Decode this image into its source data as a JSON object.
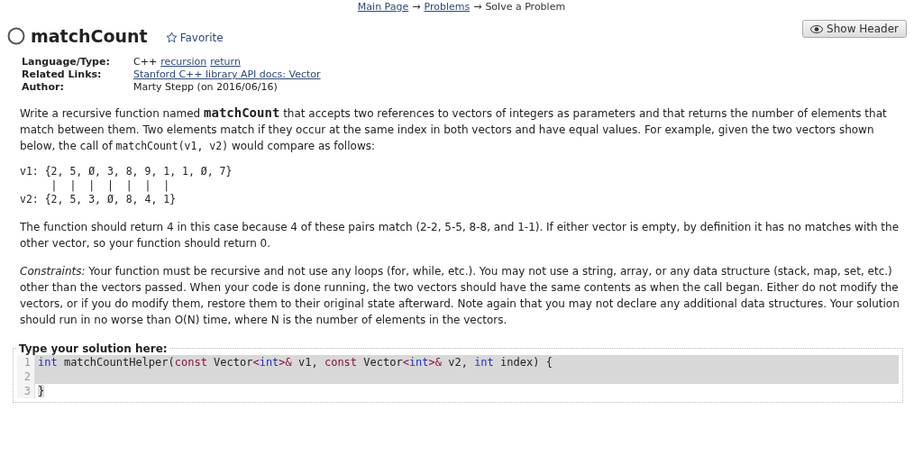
{
  "breadcrumb": [
    {
      "label": "Main Page",
      "link": true
    },
    {
      "label": "→",
      "link": false
    },
    {
      "label": "Problems",
      "link": true
    },
    {
      "label": "→",
      "link": false
    },
    {
      "label": "Solve a Problem",
      "link": false
    }
  ],
  "show_header_button": "Show Header",
  "title": "matchCount",
  "solved": false,
  "favorite": {
    "label": "Favorite",
    "on": false
  },
  "meta": [
    {
      "label": "Language/Type:",
      "values": [
        {
          "text": "C++",
          "link": false
        },
        {
          "text": "recursion",
          "link": true
        },
        {
          "text": "return",
          "link": true
        }
      ]
    },
    {
      "label": "Related Links:",
      "values": [
        {
          "text": "Stanford C++ library API docs: Vector",
          "link": true
        }
      ]
    },
    {
      "label": "Author:",
      "values": [
        {
          "text": "Marty Stepp (on 2016/06/16)",
          "link": false
        }
      ]
    }
  ],
  "intro": [
    {
      "kind": "text",
      "text": "Write a recursive function named "
    },
    {
      "kind": "code-bold",
      "text": "matchCount"
    },
    {
      "kind": "text",
      "text": " that accepts two references to vectors of integers as parameters and that returns the number of elements that match between them. Two elements match if they occur at the same index in both vectors and have equal values. For example, given the two vectors shown below, the call of "
    },
    {
      "kind": "code",
      "text": "matchCount(v1, v2)"
    },
    {
      "kind": "text",
      "text": " would compare as follows:"
    }
  ],
  "example": [
    "v1: {2, 5, Ø, 3, 8, 9, 1, 1, Ø, 7}",
    "     |  |  |  |  |  |  |",
    "v2: {2, 5, 3, Ø, 8, 4, 1}"
  ],
  "explanation": "The function should return 4 in this case because 4 of these pairs match (2-2, 5-5, 8-8, and 1-1). If either vector is empty, by definition it has no matches with the other vector, so your function should return 0.",
  "constraints": "*Constraints:* Your function must be recursive and not use any loops (for, while, etc.). You may not use a string, array, or any data structure (stack, map, set, etc.) other than the vectors passed. When your code is done running, the two vectors should have the same contents as when the call began. Either do not modify the vectors, or if you do modify them, restore them to their original state afterward. Note again that you may not declare any additional data structures. Your solution should run in no worse than O(N) time, where N is the number of elements in the vectors.",
  "editor": {
    "legend": "Type your solution here:",
    "lines": [
      {
        "number": "1",
        "highlighted": true,
        "tokens": [
          {
            "kind": "type",
            "text": "int"
          },
          {
            "kind": "plain",
            "text": " matchCountHelper("
          },
          {
            "kind": "keyword",
            "text": "const"
          },
          {
            "kind": "plain",
            "text": " Vector"
          },
          {
            "kind": "keyword",
            "text": "<"
          },
          {
            "kind": "type",
            "text": "int"
          },
          {
            "kind": "keyword",
            "text": ">&"
          },
          {
            "kind": "plain",
            "text": " v1, "
          },
          {
            "kind": "keyword",
            "text": "const"
          },
          {
            "kind": "plain",
            "text": " Vector"
          },
          {
            "kind": "keyword",
            "text": "<"
          },
          {
            "kind": "type",
            "text": "int"
          },
          {
            "kind": "keyword",
            "text": ">&"
          },
          {
            "kind": "plain",
            "text": " v2, "
          },
          {
            "kind": "type",
            "text": "int"
          },
          {
            "kind": "plain",
            "text": " index) {"
          }
        ]
      },
      {
        "number": "2",
        "highlighted": true
      },
      {
        "number": "3",
        "highlighted": false,
        "tokens": [
          {
            "kind": "plain",
            "text": "}"
          }
        ]
      }
    ]
  }
}
